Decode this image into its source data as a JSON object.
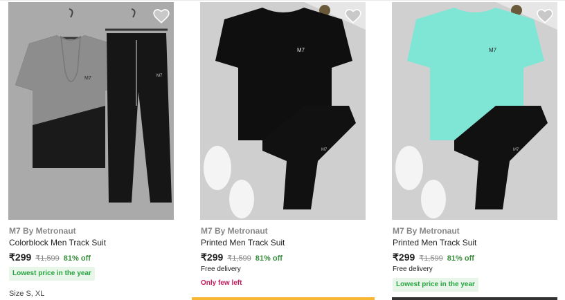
{
  "products": [
    {
      "brand": "M7 By Metronaut",
      "title": "Colorblock Men Track Suit",
      "price": "₹299",
      "mrp": "₹1,599",
      "discount": "81% off",
      "badge": "Lowest price in the year",
      "size": "Size S, XL",
      "tshirt_color": "#8a8a8a",
      "bg_color": "#9c9c9c"
    },
    {
      "brand": "M7 By Metronaut",
      "title": "Printed Men Track Suit",
      "price": "₹299",
      "mrp": "₹1,599",
      "discount": "81% off",
      "delivery": "Free delivery",
      "stock_note": "Only few left",
      "tshirt_color": "#111111",
      "bg_color": "#cfcfcf"
    },
    {
      "brand": "M7 By Metronaut",
      "title": "Printed Men Track Suit",
      "price": "₹299",
      "mrp": "₹1,599",
      "discount": "81% off",
      "delivery": "Free delivery",
      "badge": "Lowest price in the year",
      "tshirt_color": "#7fe6d6",
      "bg_color": "#d0d0d0"
    }
  ],
  "icons": {
    "wishlist": "heart-icon"
  },
  "colors": {
    "discount_green": "#388e3c",
    "badge_bg": "#e8f5e9",
    "few_left": "#c2185b"
  }
}
